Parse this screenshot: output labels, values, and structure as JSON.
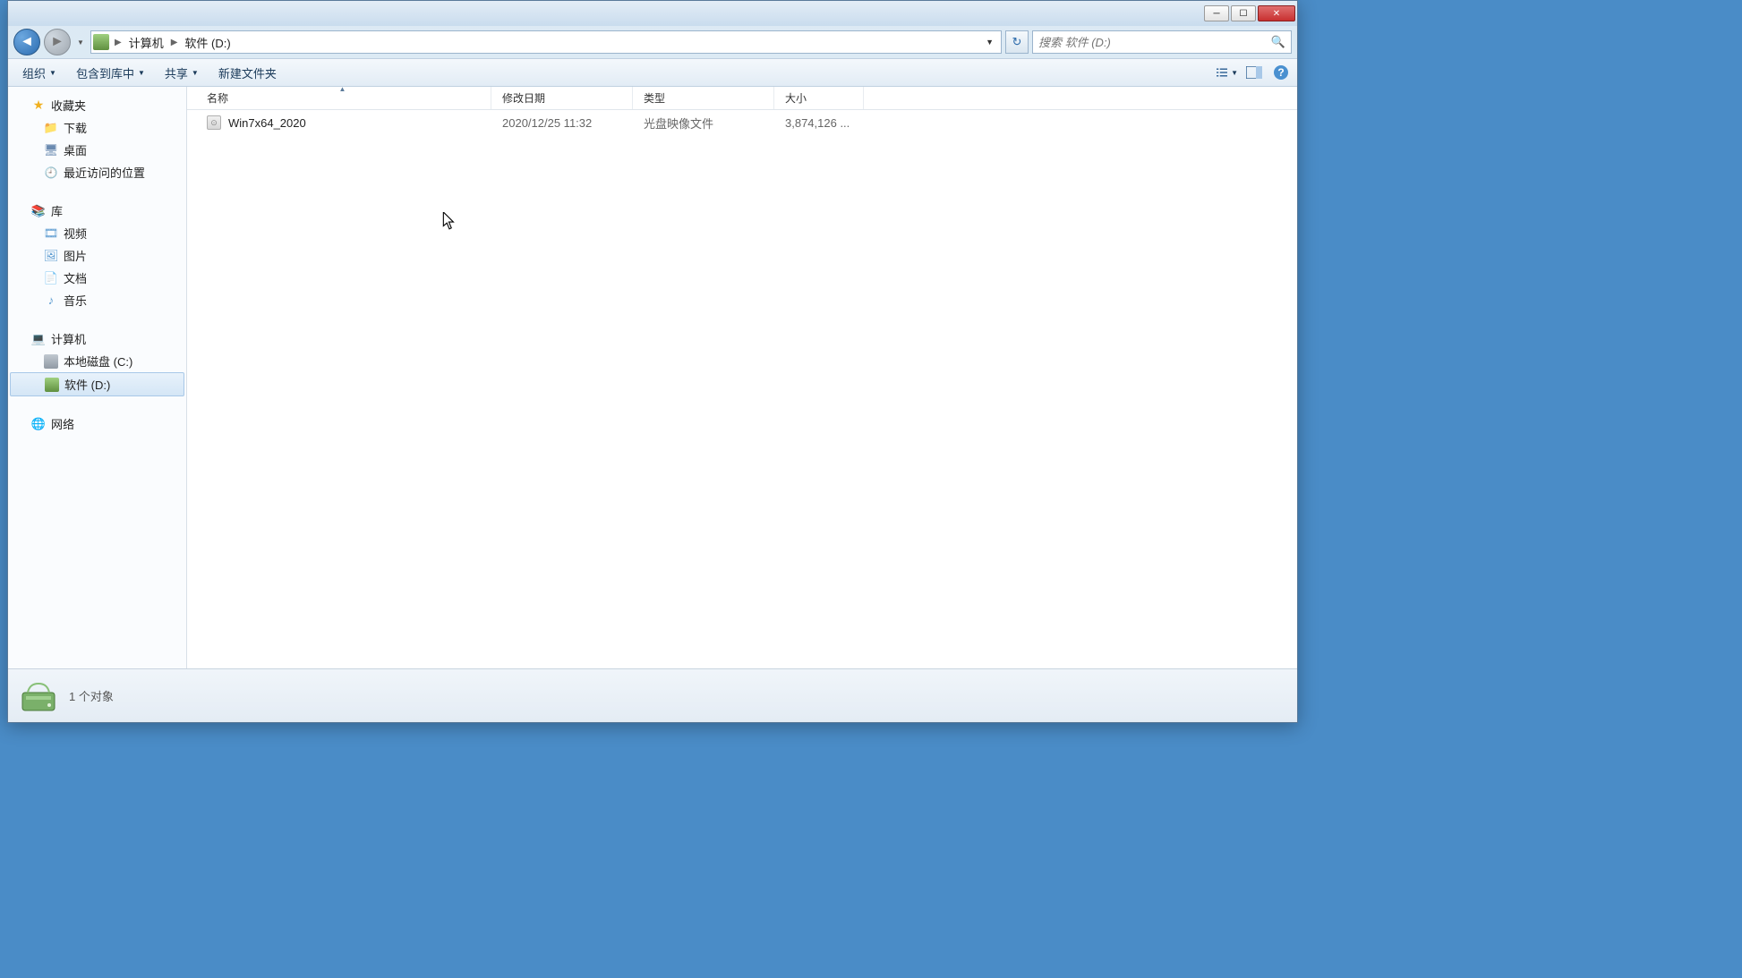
{
  "titlebar": {},
  "nav": {
    "path_segments": [
      "计算机",
      "软件 (D:)"
    ]
  },
  "search": {
    "placeholder": "搜索 软件 (D:)"
  },
  "toolbar": {
    "organize": "组织",
    "include_library": "包含到库中",
    "share": "共享",
    "new_folder": "新建文件夹"
  },
  "sidebar": {
    "favorites": {
      "label": "收藏夹",
      "items": [
        "下载",
        "桌面",
        "最近访问的位置"
      ]
    },
    "libraries": {
      "label": "库",
      "items": [
        "视频",
        "图片",
        "文档",
        "音乐"
      ]
    },
    "computer": {
      "label": "计算机",
      "items": [
        "本地磁盘 (C:)",
        "软件 (D:)"
      ]
    },
    "network": {
      "label": "网络"
    }
  },
  "columns": {
    "name": "名称",
    "date": "修改日期",
    "type": "类型",
    "size": "大小"
  },
  "files": [
    {
      "name": "Win7x64_2020",
      "date": "2020/12/25 11:32",
      "type": "光盘映像文件",
      "size": "3,874,126 ..."
    }
  ],
  "status": {
    "text": "1 个对象"
  }
}
